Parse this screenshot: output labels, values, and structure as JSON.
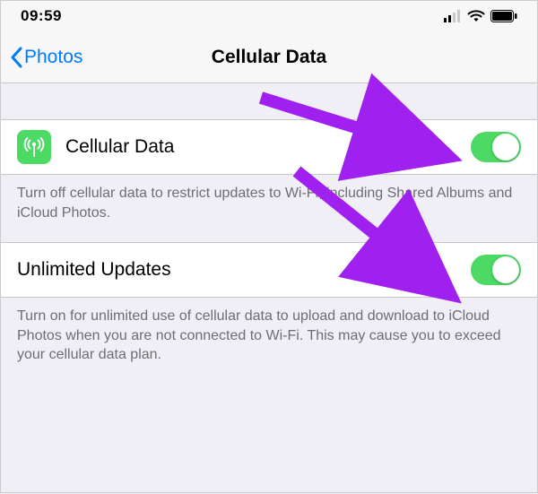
{
  "status": {
    "time": "09:59"
  },
  "nav": {
    "back_label": "Photos",
    "title": "Cellular Data"
  },
  "rows": {
    "cellular": {
      "label": "Cellular Data",
      "footer": "Turn off cellular data to restrict updates to Wi-Fi, including Shared Albums and iCloud Photos.",
      "on": true
    },
    "unlimited": {
      "label": "Unlimited Updates",
      "footer": "Turn on for unlimited use of cellular data to upload and download to iCloud Photos when you are not connected to Wi-Fi. This may cause you to exceed your cellular data plan.",
      "on": true
    }
  },
  "colors": {
    "tint": "#007aff",
    "toggle_on": "#4cd964",
    "annotation": "#a020f0"
  }
}
